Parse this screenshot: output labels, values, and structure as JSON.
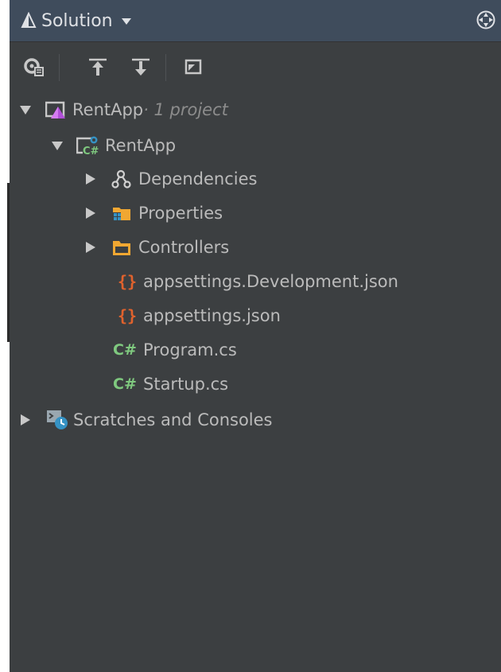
{
  "header": {
    "title": "Solution",
    "title_icon": "solution-icon",
    "dropdown_icon": "chevron-down-icon",
    "locate_icon": "crosshair-icon"
  },
  "toolbar": {
    "buttons": [
      {
        "name": "show-active-file-icon"
      },
      {
        "name": "collapse-all-icon"
      },
      {
        "name": "expand-all-icon"
      },
      {
        "name": "preview-icon"
      }
    ]
  },
  "tree": {
    "solution": {
      "label": "RentApp",
      "suffix": " · 1 project",
      "icon": "solution-node-icon",
      "expanded": true
    },
    "project": {
      "label": "RentApp",
      "icon": "csharp-project-icon",
      "expanded": true
    },
    "children": [
      {
        "label": "Dependencies",
        "icon": "dependencies-icon",
        "expandable": true
      },
      {
        "label": "Properties",
        "icon": "properties-folder-icon",
        "expandable": true
      },
      {
        "label": "Controllers",
        "icon": "folder-icon",
        "expandable": true
      },
      {
        "label": "appsettings.Development.json",
        "icon": "json-icon",
        "glyph": "{}"
      },
      {
        "label": "appsettings.json",
        "icon": "json-icon",
        "glyph": "{}"
      },
      {
        "label": "Program.cs",
        "icon": "csharp-file-icon",
        "glyph": "C#"
      },
      {
        "label": "Startup.cs",
        "icon": "csharp-file-icon",
        "glyph": "C#"
      }
    ],
    "scratches": {
      "label": "Scratches and Consoles",
      "icon": "scratches-icon",
      "expandable": true
    }
  },
  "colors": {
    "panel_bg": "#3c3f41",
    "header_bg": "#3f4c5c",
    "text": "#bbbbbb",
    "json_orange": "#e0622d",
    "csharp_green": "#7fc97f",
    "folder_orange": "#f0a732",
    "accent_blue": "#3592c4"
  }
}
